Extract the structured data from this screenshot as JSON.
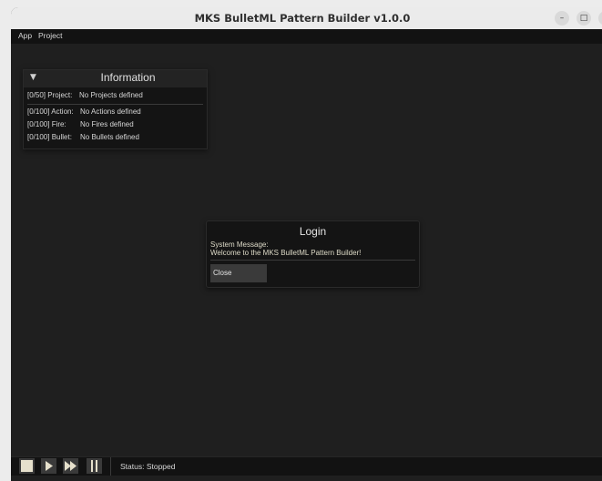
{
  "window": {
    "title": "MKS BulletML Pattern Builder v1.0.0",
    "controls": {
      "minimize": "–",
      "maximize": "□",
      "close": "×"
    }
  },
  "menu": {
    "items": [
      "App",
      "Project"
    ]
  },
  "info_panel": {
    "toggle_icon": "▼",
    "title": "Information",
    "project": {
      "label": "[0/50] Project:",
      "value": "No Projects defined"
    },
    "action": {
      "label": "[0/100] Action:",
      "value": "No Actions defined"
    },
    "fire": {
      "label": "[0/100] Fire:",
      "value": "No Fires defined"
    },
    "bullet": {
      "label": "[0/100] Bullet:",
      "value": "No Bullets defined"
    }
  },
  "dialog": {
    "title": "Login",
    "label": "System Message:",
    "message": "Welcome to the MKS BulletML Pattern Builder!",
    "close_label": "Close"
  },
  "toolbar": {
    "icons": [
      "stop-icon",
      "play-icon",
      "fast-forward-icon",
      "pause-icon"
    ]
  },
  "status": {
    "text": "Status: Stopped"
  },
  "colors": {
    "background": "#1f1f1f",
    "panel": "#141414",
    "message_text": "#dedbc8",
    "button": "#3a3a3a"
  }
}
